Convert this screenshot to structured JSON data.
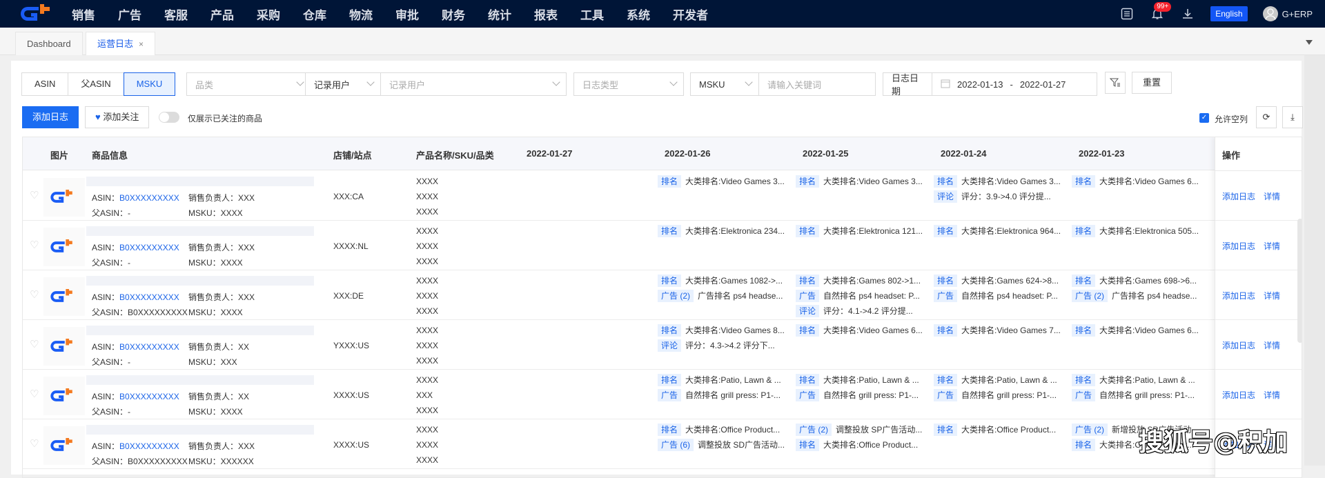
{
  "nav": {
    "menu": [
      "销售",
      "广告",
      "客服",
      "产品",
      "采购",
      "仓库",
      "物流",
      "审批",
      "财务",
      "统计",
      "报表",
      "工具",
      "系统",
      "开发者"
    ],
    "badge": "99+",
    "language_btn": "English",
    "user": "G+ERP"
  },
  "tabs": [
    {
      "label": "Dashboard",
      "active": false
    },
    {
      "label": "运营日志",
      "active": true,
      "close": "×"
    }
  ],
  "filters": {
    "segments": [
      "ASIN",
      "父ASIN",
      "MSKU"
    ],
    "segment_active": "MSKU",
    "category_placeholder": "品类",
    "recorder_select": "记录用户",
    "recorder_placeholder": "记录用户",
    "log_type_placeholder": "日志类型",
    "keyword_select": "MSKU",
    "keyword_placeholder": "请输入关键词",
    "date_label": "日志日期",
    "date_start": "2022-01-13",
    "date_sep": "-",
    "date_end": "2022-01-27",
    "reset_btn": "重置"
  },
  "actions": {
    "add_log": "添加日志",
    "add_follow": "添加关注",
    "only_followed": "仅展示已关注的商品",
    "allow_empty": "允许空列",
    "allow_empty_checked": true
  },
  "table": {
    "columns": [
      "图片",
      "商品信息",
      "店铺/站点",
      "产品名称/SKU/品类",
      "2022-01-27",
      "2022-01-26",
      "2022-01-25",
      "2022-01-24",
      "2022-01-23",
      "操作"
    ],
    "ops": {
      "add_log": "添加日志",
      "detail": "详情"
    },
    "rows": [
      {
        "asin_label": "ASIN：",
        "asin": "B0XXXXXXXXX",
        "parent_label": "父ASIN：",
        "parent": "-",
        "seller_label": "销售负责人：",
        "seller": "XXX",
        "msku_label": "MSKU：",
        "msku": "XXXX",
        "shop": "XXX:CA",
        "names": [
          "XXXX",
          "XXXX",
          "XXXX"
        ],
        "logs": [
          [],
          [
            {
              "tag": "排名",
              "text": "大类排名:Video Games 3..."
            }
          ],
          [
            {
              "tag": "排名",
              "text": "大类排名:Video Games 3..."
            }
          ],
          [
            {
              "tag": "排名",
              "text": "大类排名:Video Games 3..."
            },
            {
              "tag": "评论",
              "text": "评分：3.9->4.0 评分提..."
            }
          ],
          [
            {
              "tag": "排名",
              "text": "大类排名:Video Games 6..."
            }
          ]
        ]
      },
      {
        "asin_label": "ASIN：",
        "asin": "B0XXXXXXXXX",
        "parent_label": "父ASIN：",
        "parent": "-",
        "seller_label": "销售负责人：",
        "seller": "XXX",
        "msku_label": "MSKU：",
        "msku": "XXXX",
        "shop": "XXXX:NL",
        "names": [
          "XXXX",
          "XXXX",
          "XXXX"
        ],
        "logs": [
          [],
          [
            {
              "tag": "排名",
              "text": "大类排名:Elektronica 234..."
            }
          ],
          [
            {
              "tag": "排名",
              "text": "大类排名:Elektronica 121..."
            }
          ],
          [
            {
              "tag": "排名",
              "text": "大类排名:Elektronica 964..."
            }
          ],
          [
            {
              "tag": "排名",
              "text": "大类排名:Elektronica 505..."
            }
          ]
        ]
      },
      {
        "asin_label": "ASIN：",
        "asin": "B0XXXXXXXXX",
        "parent_label": "父ASIN：",
        "parent": "B0XXXXXXXXX",
        "seller_label": "销售负责人：",
        "seller": "XXX",
        "msku_label": "MSKU：",
        "msku": "XXXX",
        "shop": "XXX:DE",
        "names": [
          "XXXX",
          "XXXX",
          "XXXX"
        ],
        "logs": [
          [],
          [
            {
              "tag": "排名",
              "text": "大类排名:Games 1082->..."
            },
            {
              "tag": "广告 (2)",
              "text": "广告排名 ps4 headse..."
            }
          ],
          [
            {
              "tag": "排名",
              "text": "大类排名:Games 802->1..."
            },
            {
              "tag": "广告",
              "text": "自然排名 ps4 headset: P..."
            },
            {
              "tag": "评论",
              "text": "评分：4.1->4.2 评分提..."
            }
          ],
          [
            {
              "tag": "排名",
              "text": "大类排名:Games 624->8..."
            },
            {
              "tag": "广告",
              "text": "自然排名 ps4 headset: P..."
            }
          ],
          [
            {
              "tag": "排名",
              "text": "大类排名:Games 698->6..."
            },
            {
              "tag": "广告 (2)",
              "text": "广告排名 ps4 headse..."
            }
          ]
        ]
      },
      {
        "asin_label": "ASIN：",
        "asin": "B0XXXXXXXXX",
        "parent_label": "父ASIN：",
        "parent": "-",
        "seller_label": "销售负责人：",
        "seller": "XX",
        "msku_label": "MSKU：",
        "msku": "XXX",
        "shop": "YXXX:US",
        "names": [
          "XXXX",
          "XXXX",
          "XXXX"
        ],
        "logs": [
          [],
          [
            {
              "tag": "排名",
              "text": "大类排名:Video Games 8..."
            },
            {
              "tag": "评论",
              "text": "评分：4.3->4.2 评分下..."
            }
          ],
          [
            {
              "tag": "排名",
              "text": "大类排名:Video Games 6..."
            }
          ],
          [
            {
              "tag": "排名",
              "text": "大类排名:Video Games 7..."
            }
          ],
          [
            {
              "tag": "排名",
              "text": "大类排名:Video Games 6..."
            }
          ]
        ]
      },
      {
        "asin_label": "ASIN：",
        "asin": "B0XXXXXXXXX",
        "parent_label": "父ASIN：",
        "parent": "-",
        "seller_label": "销售负责人：",
        "seller": "XX",
        "msku_label": "MSKU：",
        "msku": "XXXX",
        "shop": "XXXX:US",
        "names": [
          "XXXX",
          "XXX",
          "XXXX"
        ],
        "logs": [
          [],
          [
            {
              "tag": "排名",
              "text": "大类排名:Patio, Lawn & ..."
            },
            {
              "tag": "广告",
              "text": "自然排名 grill press: P1-..."
            }
          ],
          [
            {
              "tag": "排名",
              "text": "大类排名:Patio, Lawn & ..."
            },
            {
              "tag": "广告",
              "text": "自然排名 grill press: P1-..."
            }
          ],
          [
            {
              "tag": "排名",
              "text": "大类排名:Patio, Lawn & ..."
            },
            {
              "tag": "广告",
              "text": "自然排名 grill press: P1-..."
            }
          ],
          [
            {
              "tag": "排名",
              "text": "大类排名:Patio, Lawn & ..."
            },
            {
              "tag": "广告",
              "text": "自然排名 grill press: P1-..."
            }
          ]
        ]
      },
      {
        "asin_label": "ASIN：",
        "asin": "B0XXXXXXXXX",
        "parent_label": "父ASIN：",
        "parent": "B0XXXXXXXXX",
        "seller_label": "销售负责人：",
        "seller": "XXX",
        "msku_label": "MSKU：",
        "msku": "XXXXXX",
        "shop": "XXXX:US",
        "names": [
          "XXXX",
          "XXXX",
          "XXXX"
        ],
        "logs": [
          [],
          [
            {
              "tag": "排名",
              "text": "大类排名:Office Product..."
            },
            {
              "tag": "广告 (6)",
              "text": "调整投放 SD广告活动..."
            }
          ],
          [
            {
              "tag": "广告 (2)",
              "text": "调整投放 SP广告活动..."
            },
            {
              "tag": "排名",
              "text": "大类排名:Office Product..."
            }
          ],
          [
            {
              "tag": "排名",
              "text": "大类排名:Office Product..."
            }
          ],
          [
            {
              "tag": "广告 (2)",
              "text": "新增投放 SP广告活动..."
            },
            {
              "tag": "排名",
              "text": "大类排名:Office Product..."
            }
          ]
        ]
      }
    ]
  },
  "watermark": "搜狐号@积加",
  "colors": {
    "nav_bg": "#001537",
    "primary": "#1a6cf2",
    "link": "#1a63e8",
    "tag_bg": "#e8f1fe",
    "logo_orange": "#f47a20"
  }
}
